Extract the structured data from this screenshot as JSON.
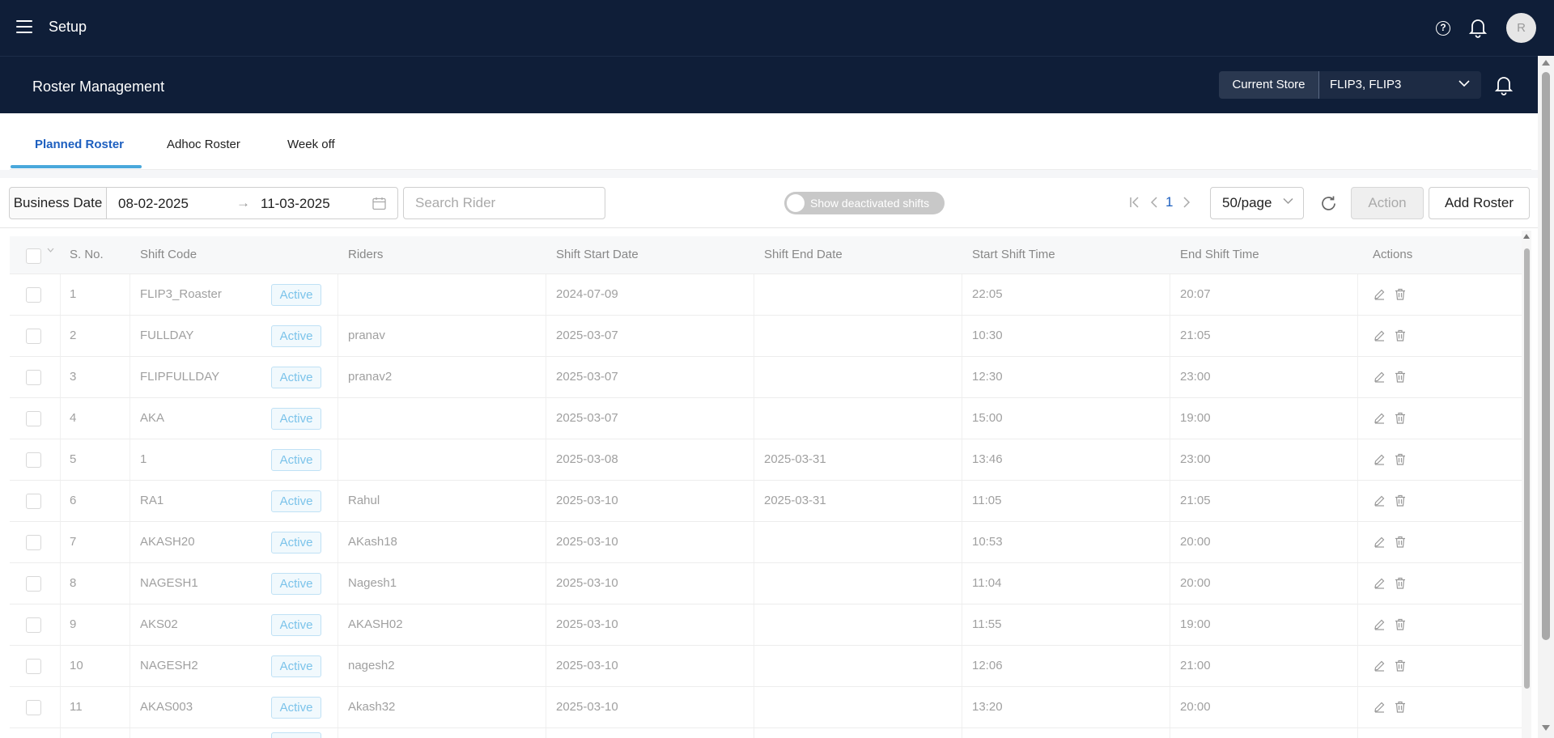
{
  "app": {
    "title": "Setup",
    "avatar_initial": "R"
  },
  "subheader": {
    "title": "Roster Management",
    "store_label": "Current Store",
    "store_value": "FLIP3, FLIP3"
  },
  "tabs": [
    {
      "label": "Planned Roster",
      "active": true
    },
    {
      "label": "Adhoc Roster",
      "active": false
    },
    {
      "label": "Week off",
      "active": false
    }
  ],
  "filters": {
    "business_date_label": "Business Date",
    "date_from": "08-02-2025",
    "date_to": "11-03-2025",
    "search_placeholder": "Search Rider",
    "toggle_label": "Show deactivated shifts",
    "toggle_on": false
  },
  "pagination": {
    "current_page": "1",
    "page_size": "50/page"
  },
  "buttons": {
    "action": "Action",
    "add_roster": "Add Roster"
  },
  "table": {
    "columns": [
      "S. No.",
      "Shift Code",
      "Riders",
      "Shift Start Date",
      "Shift End Date",
      "Start Shift Time",
      "End Shift Time",
      "Actions"
    ],
    "rows": [
      {
        "sno": "1",
        "code": "FLIP3_Roaster",
        "status": "Active",
        "riders": "",
        "start_date": "2024-07-09",
        "end_date": "",
        "start_time": "22:05",
        "end_time": "20:07"
      },
      {
        "sno": "2",
        "code": "FULLDAY",
        "status": "Active",
        "riders": "pranav",
        "start_date": "2025-03-07",
        "end_date": "",
        "start_time": "10:30",
        "end_time": "21:05"
      },
      {
        "sno": "3",
        "code": "FLIPFULLDAY",
        "status": "Active",
        "riders": "pranav2",
        "start_date": "2025-03-07",
        "end_date": "",
        "start_time": "12:30",
        "end_time": "23:00"
      },
      {
        "sno": "4",
        "code": "AKA",
        "status": "Active",
        "riders": "",
        "start_date": "2025-03-07",
        "end_date": "",
        "start_time": "15:00",
        "end_time": "19:00"
      },
      {
        "sno": "5",
        "code": "1",
        "status": "Active",
        "riders": "",
        "start_date": "2025-03-08",
        "end_date": "2025-03-31",
        "start_time": "13:46",
        "end_time": "23:00"
      },
      {
        "sno": "6",
        "code": "RA1",
        "status": "Active",
        "riders": "Rahul",
        "start_date": "2025-03-10",
        "end_date": "2025-03-31",
        "start_time": "11:05",
        "end_time": "21:05"
      },
      {
        "sno": "7",
        "code": "AKASH20",
        "status": "Active",
        "riders": "AKash18",
        "start_date": "2025-03-10",
        "end_date": "",
        "start_time": "10:53",
        "end_time": "20:00"
      },
      {
        "sno": "8",
        "code": "NAGESH1",
        "status": "Active",
        "riders": "Nagesh1",
        "start_date": "2025-03-10",
        "end_date": "",
        "start_time": "11:04",
        "end_time": "20:00"
      },
      {
        "sno": "9",
        "code": "AKS02",
        "status": "Active",
        "riders": "AKASH02",
        "start_date": "2025-03-10",
        "end_date": "",
        "start_time": "11:55",
        "end_time": "19:00"
      },
      {
        "sno": "10",
        "code": "NAGESH2",
        "status": "Active",
        "riders": "nagesh2",
        "start_date": "2025-03-10",
        "end_date": "",
        "start_time": "12:06",
        "end_time": "21:00"
      },
      {
        "sno": "11",
        "code": "AKAS003",
        "status": "Active",
        "riders": "Akash32",
        "start_date": "2025-03-10",
        "end_date": "",
        "start_time": "13:20",
        "end_time": "20:00"
      }
    ]
  },
  "icons": {
    "menu": "hamburger-icon",
    "help": "help-icon",
    "notifications": "bell-icon",
    "calendar": "calendar-icon",
    "refresh": "refresh-icon",
    "edit": "edit-icon",
    "delete": "delete-icon"
  },
  "colors": {
    "header_bg": "#0f1e38",
    "accent": "#1d5fbf",
    "tab_underline": "#4aa8db",
    "active_badge": "#7bc3ea"
  }
}
